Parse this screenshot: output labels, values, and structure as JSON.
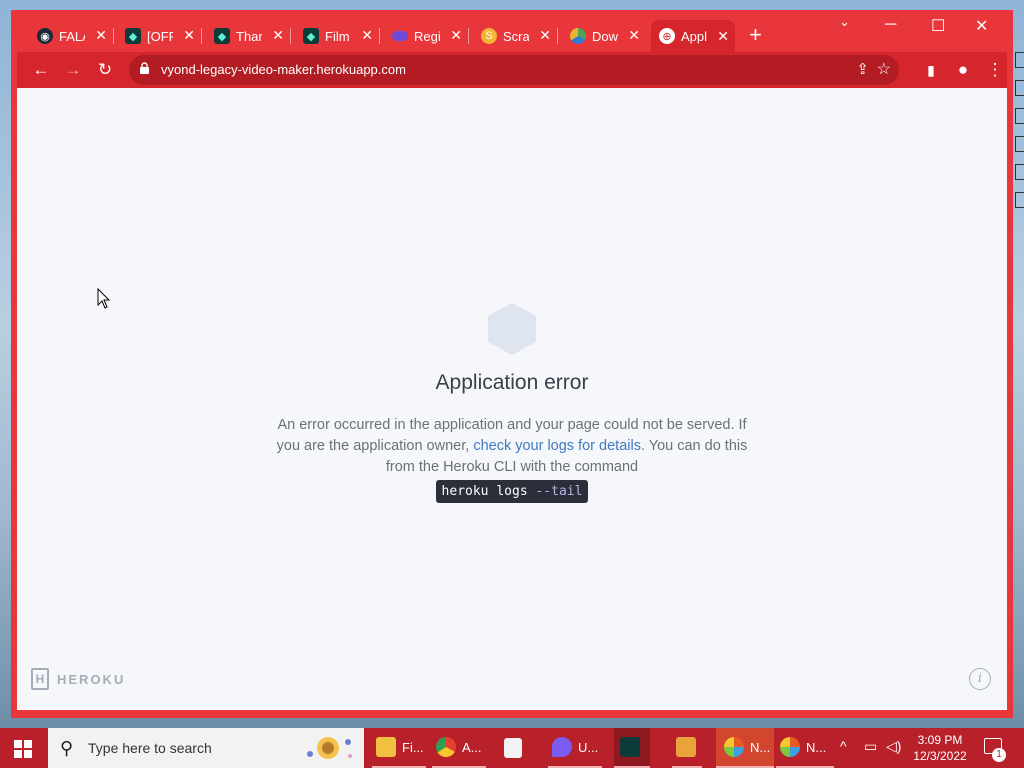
{
  "browser": {
    "tabs": [
      {
        "label": "FALA",
        "icon": "globe-dark-icon",
        "color": "#1a2a3a"
      },
      {
        "label": "[OFF",
        "icon": "filmora-icon",
        "color": "#0d3b3a"
      },
      {
        "label": "Thar",
        "icon": "filmora-icon",
        "color": "#0d3b3a"
      },
      {
        "label": "Film",
        "icon": "filmora-icon",
        "color": "#0d3b3a"
      },
      {
        "label": "Regi",
        "icon": "registration-icon",
        "color": "#6d4bd8"
      },
      {
        "label": "Scrat",
        "icon": "scratch-icon",
        "color": "#f3b533"
      },
      {
        "label": "Dow",
        "icon": "download-site-icon",
        "color": "#4aa655"
      },
      {
        "label": "Appl",
        "icon": "globe-icon",
        "color": "#ffffff"
      }
    ],
    "url": "vyond-legacy-video-maker.herokuapp.com"
  },
  "page": {
    "title": "Application error",
    "body_1": "An error occurred in the application and your page could not be served. If you are the application owner,",
    "link": "check your logs for details",
    "body_2": ". You can do this from the Heroku CLI with the command",
    "code_cmd": "heroku logs",
    "code_flag": "--tail",
    "brand": "HEROKU",
    "brand_mark": "H",
    "info_glyph": "i"
  },
  "taskbar": {
    "search_placeholder": "Type here to search",
    "apps": [
      {
        "label": "Fi...",
        "icon": "file-explorer-icon",
        "color": "#f0c040"
      },
      {
        "label": "A...",
        "icon": "chrome-icon",
        "color": "#e44133"
      },
      {
        "label": "",
        "icon": "store-icon",
        "color": "#f2f2f2"
      },
      {
        "label": "U...",
        "icon": "app-drop-icon",
        "color": "#7a5cf0"
      },
      {
        "label": "",
        "icon": "filmora-icon",
        "color": "#0d3b3a"
      },
      {
        "label": "",
        "icon": "media-icon",
        "color": "#e8a33a"
      },
      {
        "label": "N...",
        "icon": "app-n-icon",
        "color": "#e85a20"
      },
      {
        "label": "N...",
        "icon": "app-n-icon",
        "color": "#e85a20"
      }
    ],
    "time": "3:09 PM",
    "date": "12/3/2022",
    "notification_count": "1"
  }
}
